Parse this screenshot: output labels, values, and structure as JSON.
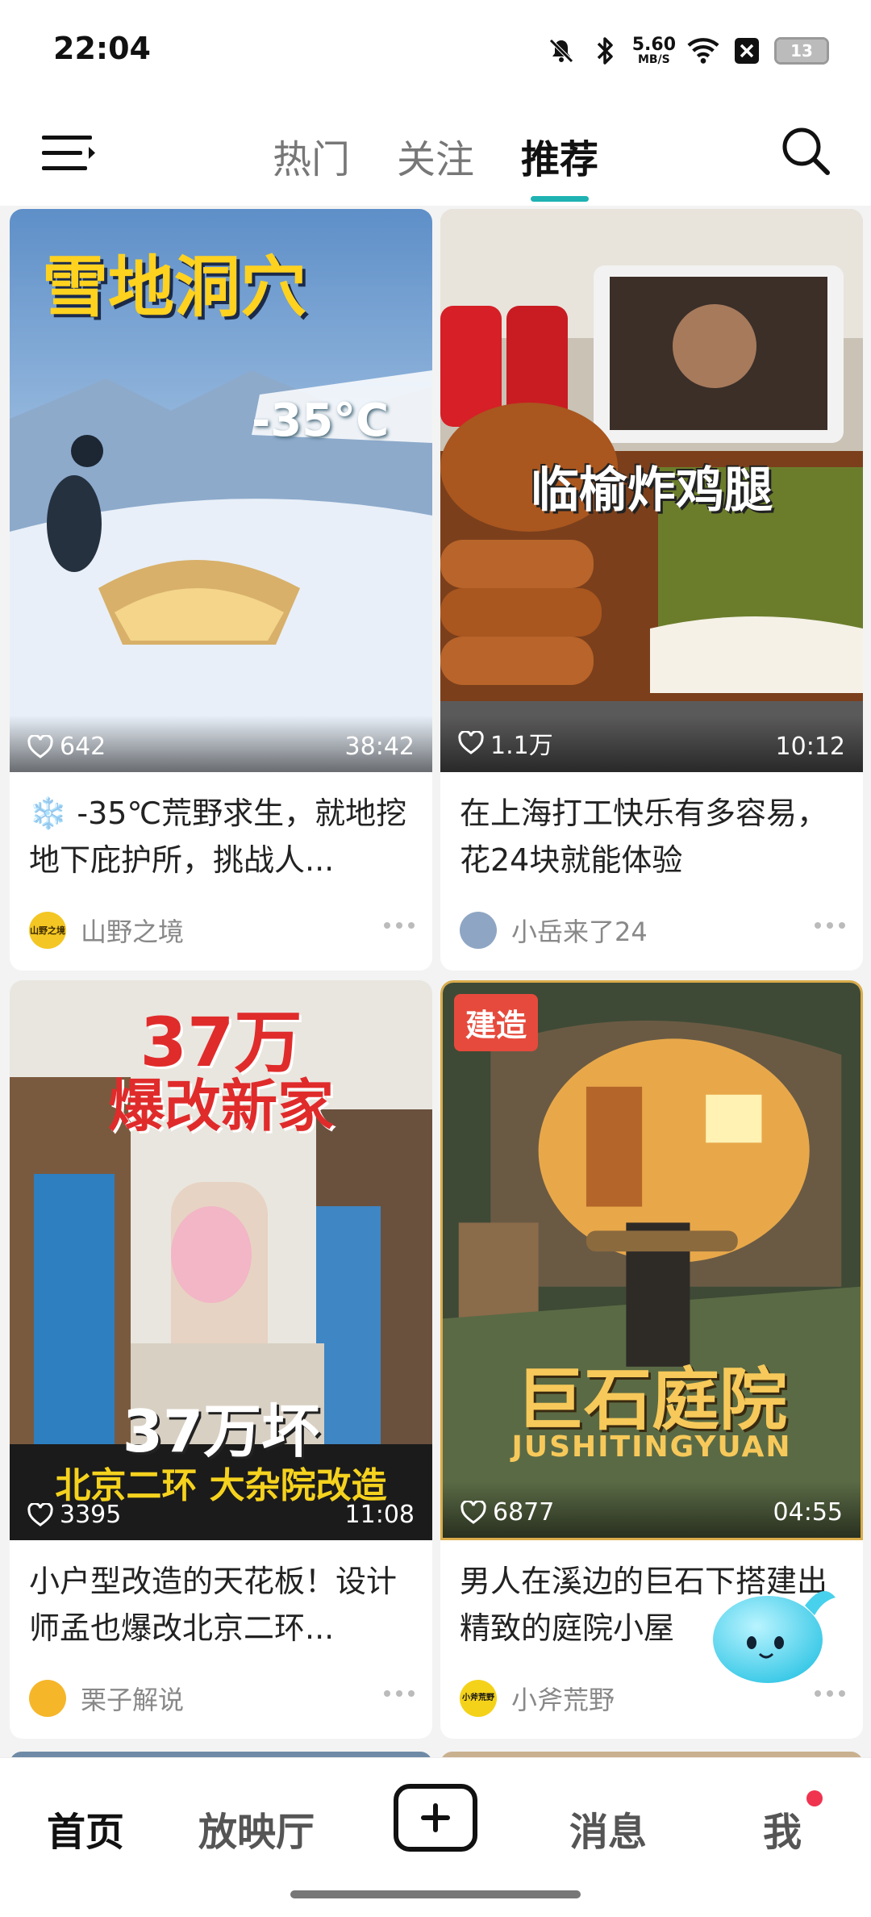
{
  "status_bar": {
    "time": "22:04",
    "net_speed_value": "5.60",
    "net_speed_unit": "MB/S",
    "battery": "13",
    "icons": [
      "bell-muted-icon",
      "bluetooth-icon",
      "wifi-icon",
      "close-box-icon",
      "battery-icon"
    ]
  },
  "header": {
    "tabs": [
      {
        "label": "热门",
        "active": false
      },
      {
        "label": "关注",
        "active": false
      },
      {
        "label": "推荐",
        "active": true
      }
    ],
    "accent_color": "#1fb2b2"
  },
  "feed": {
    "cards": [
      {
        "overlay_title": "雪地洞穴",
        "overlay_temp": "-35°C",
        "likes": "642",
        "duration": "38:42",
        "title": "❄️ -35℃荒野求生，就地挖地下庇护所，挑战人...",
        "author": "山野之境",
        "avatar_text": "山野之境"
      },
      {
        "overlay_title": "临榆炸鸡腿",
        "likes": "1.1万",
        "duration": "10:12",
        "title": "在上海打工快乐有多容易，花24块就能体验",
        "author": "小岳来了24"
      },
      {
        "overlay_title_1": "37万",
        "overlay_title_2": "爆改新家",
        "overlay_sub": "37万坏",
        "overlay_caption": "北京二环 大杂院改造",
        "likes": "3395",
        "duration": "11:08",
        "title": "小户型改造的天花板！设计师孟也爆改北京二环...",
        "author": "栗子解说"
      },
      {
        "badge": "建造",
        "overlay_title": "巨石庭院",
        "overlay_sub": "JUSHITINGYUAN",
        "likes": "6877",
        "duration": "04:55",
        "title": "男人在溪边的巨石下搭建出精致的庭院小屋",
        "author": "小斧荒野",
        "avatar_text": "小斧荒野"
      }
    ]
  },
  "bottom_nav": {
    "items": [
      {
        "label": "首页",
        "active": true
      },
      {
        "label": "放映厅",
        "active": false
      },
      {
        "label": "消息",
        "active": false
      },
      {
        "label": "我",
        "active": false
      }
    ],
    "notification_dot_color": "#f0334f"
  }
}
